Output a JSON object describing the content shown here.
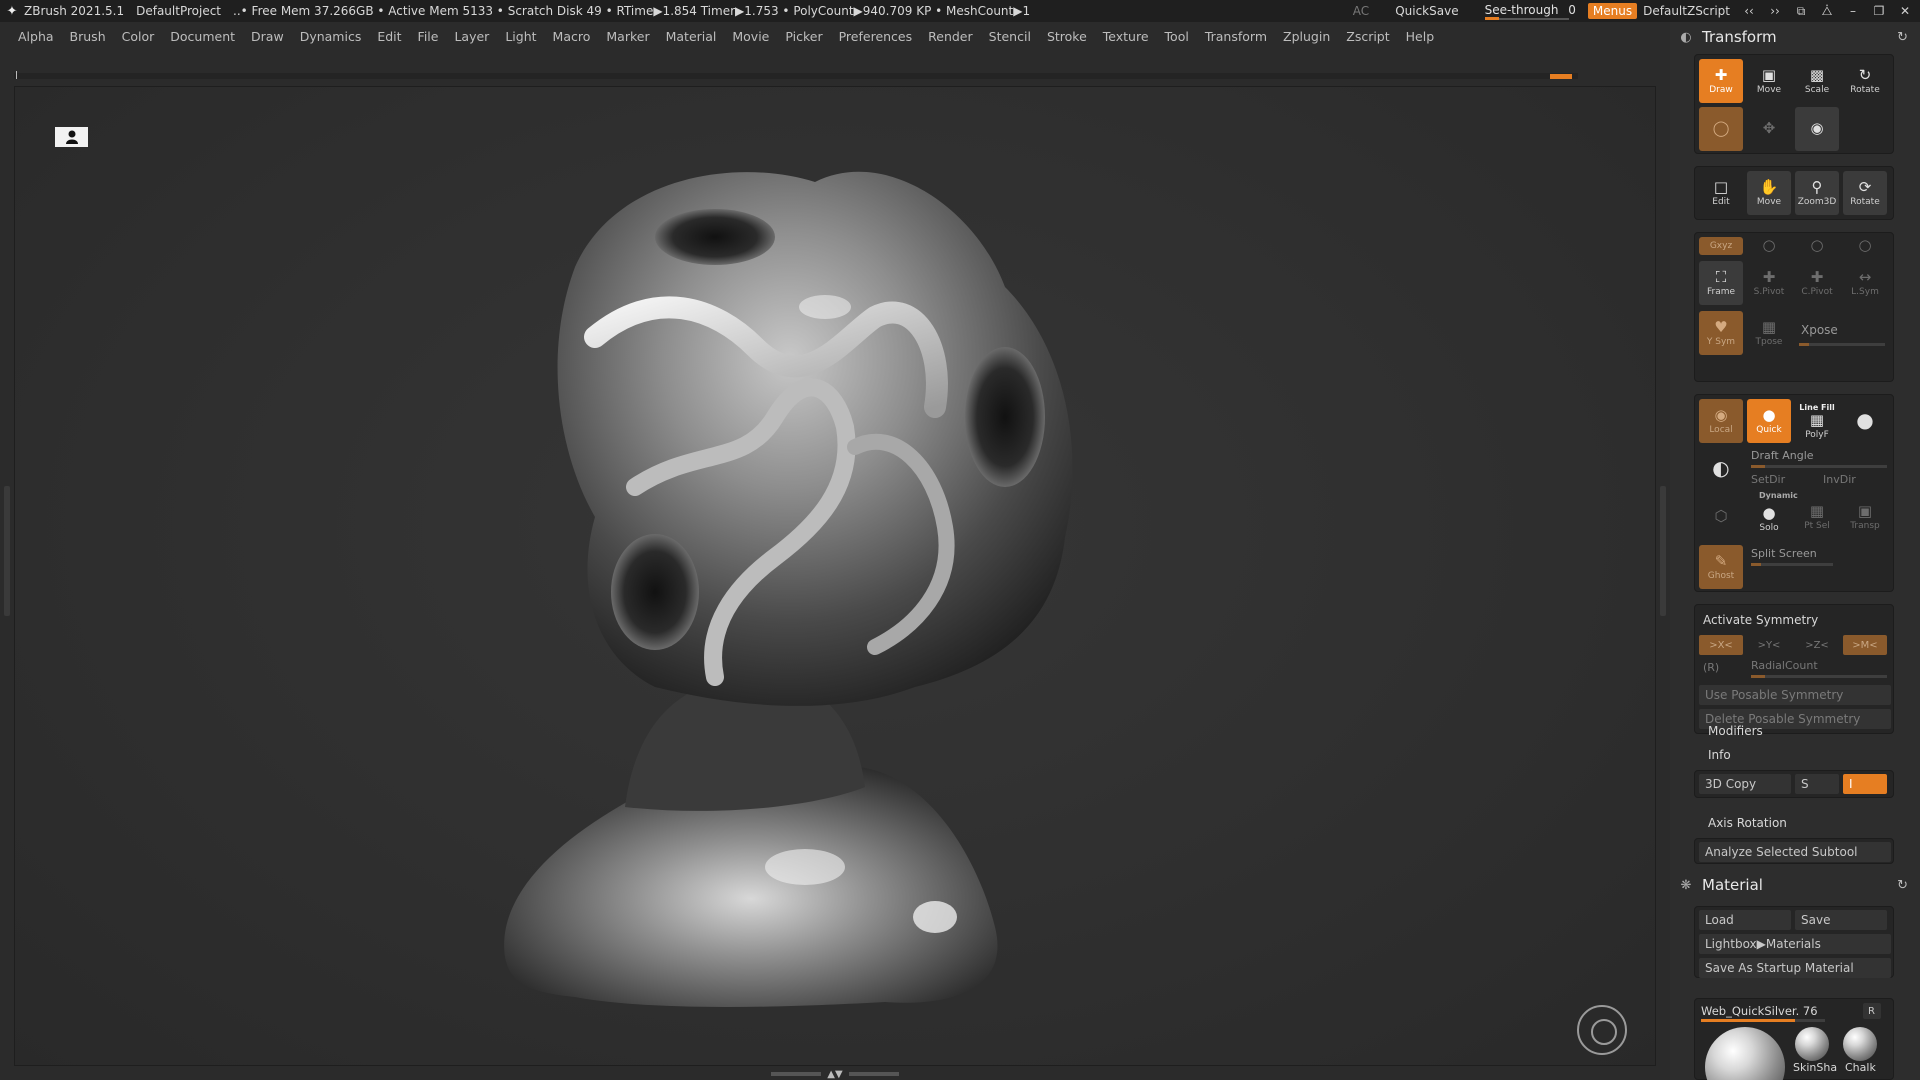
{
  "titlebar": {
    "app": "ZBrush 2021.5.1",
    "project": "DefaultProject",
    "stats": "..• Free Mem 37.266GB • Active Mem 5133 • Scratch Disk 49 •  RTime▶1.854 Timer▶1.753 • PolyCount▶940.709 KP  • MeshCount▶1",
    "ac": "AC",
    "quicksave": "QuickSave",
    "seethrough_label": "See-through",
    "seethrough_value": "0",
    "seethrough_fraction": 0,
    "menus": "Menus",
    "script": "DefaultZScript"
  },
  "menu": [
    "Alpha",
    "Brush",
    "Color",
    "Document",
    "Draw",
    "Dynamics",
    "Edit",
    "File",
    "Layer",
    "Light",
    "Macro",
    "Marker",
    "Material",
    "Movie",
    "Picker",
    "Preferences",
    "Render",
    "Stencil",
    "Stroke",
    "Texture",
    "Tool",
    "Transform",
    "Zplugin",
    "Zscript",
    "Help"
  ],
  "transform": {
    "title": "Transform",
    "draw_modes": {
      "draw": "Draw",
      "move": "Move",
      "scale": "Scale",
      "rotate": "Rotate"
    },
    "nav": {
      "edit": "Edit",
      "move": "Move",
      "zoom3d": "Zoom3D",
      "rotate": "Rotate"
    },
    "xyz": "Gxyz",
    "frame": "Frame",
    "spivot": "S.Pivot",
    "cpivot": "C.Pivot",
    "lsym": "L.Sym",
    "ysym": "Y Sym",
    "tpose": "Tpose",
    "xpose": "Xpose",
    "local": "Local",
    "quick": "Quick",
    "linefill": "Line Fill",
    "polyf": "PolyF",
    "draft_angle": "Draft Angle",
    "setdir": "SetDir",
    "invdir": "InvDir",
    "dynamic": "Dynamic",
    "solo": "Solo",
    "ptsel": "Pt Sel",
    "transp": "Transp",
    "split_screen": "Split Screen",
    "ghost": "Ghost",
    "activate_symmetry": "Activate Symmetry",
    "sym_x": ">X<",
    "sym_y": ">Y<",
    "sym_z": ">Z<",
    "sym_m": ">M<",
    "r": "(R)",
    "radial_count": "RadialCount",
    "use_posable": "Use Posable Symmetry",
    "delete_posable": "Delete Posable Symmetry",
    "modifiers": "Modifiers",
    "info": "Info",
    "copy3d": "3D Copy",
    "s": "S",
    "i": "I",
    "axis_rotation": "Axis Rotation",
    "analyze": "Analyze Selected Subtool"
  },
  "material": {
    "title": "Material",
    "load": "Load",
    "save": "Save",
    "lightbox": "Lightbox▶Materials",
    "save_startup": "Save As Startup Material",
    "current": "Web_QuickSilver. 76",
    "r": "R",
    "thumbs": [
      "SkinSha",
      "Chalk"
    ]
  },
  "colors": {
    "accent": "#e67e22",
    "panel": "#2d2d2d",
    "canvas": "#303030"
  },
  "icons": [
    "zbrush-logo-icon",
    "perspective-icon",
    "navigation-gizmo-icon",
    "reset-icon"
  ]
}
